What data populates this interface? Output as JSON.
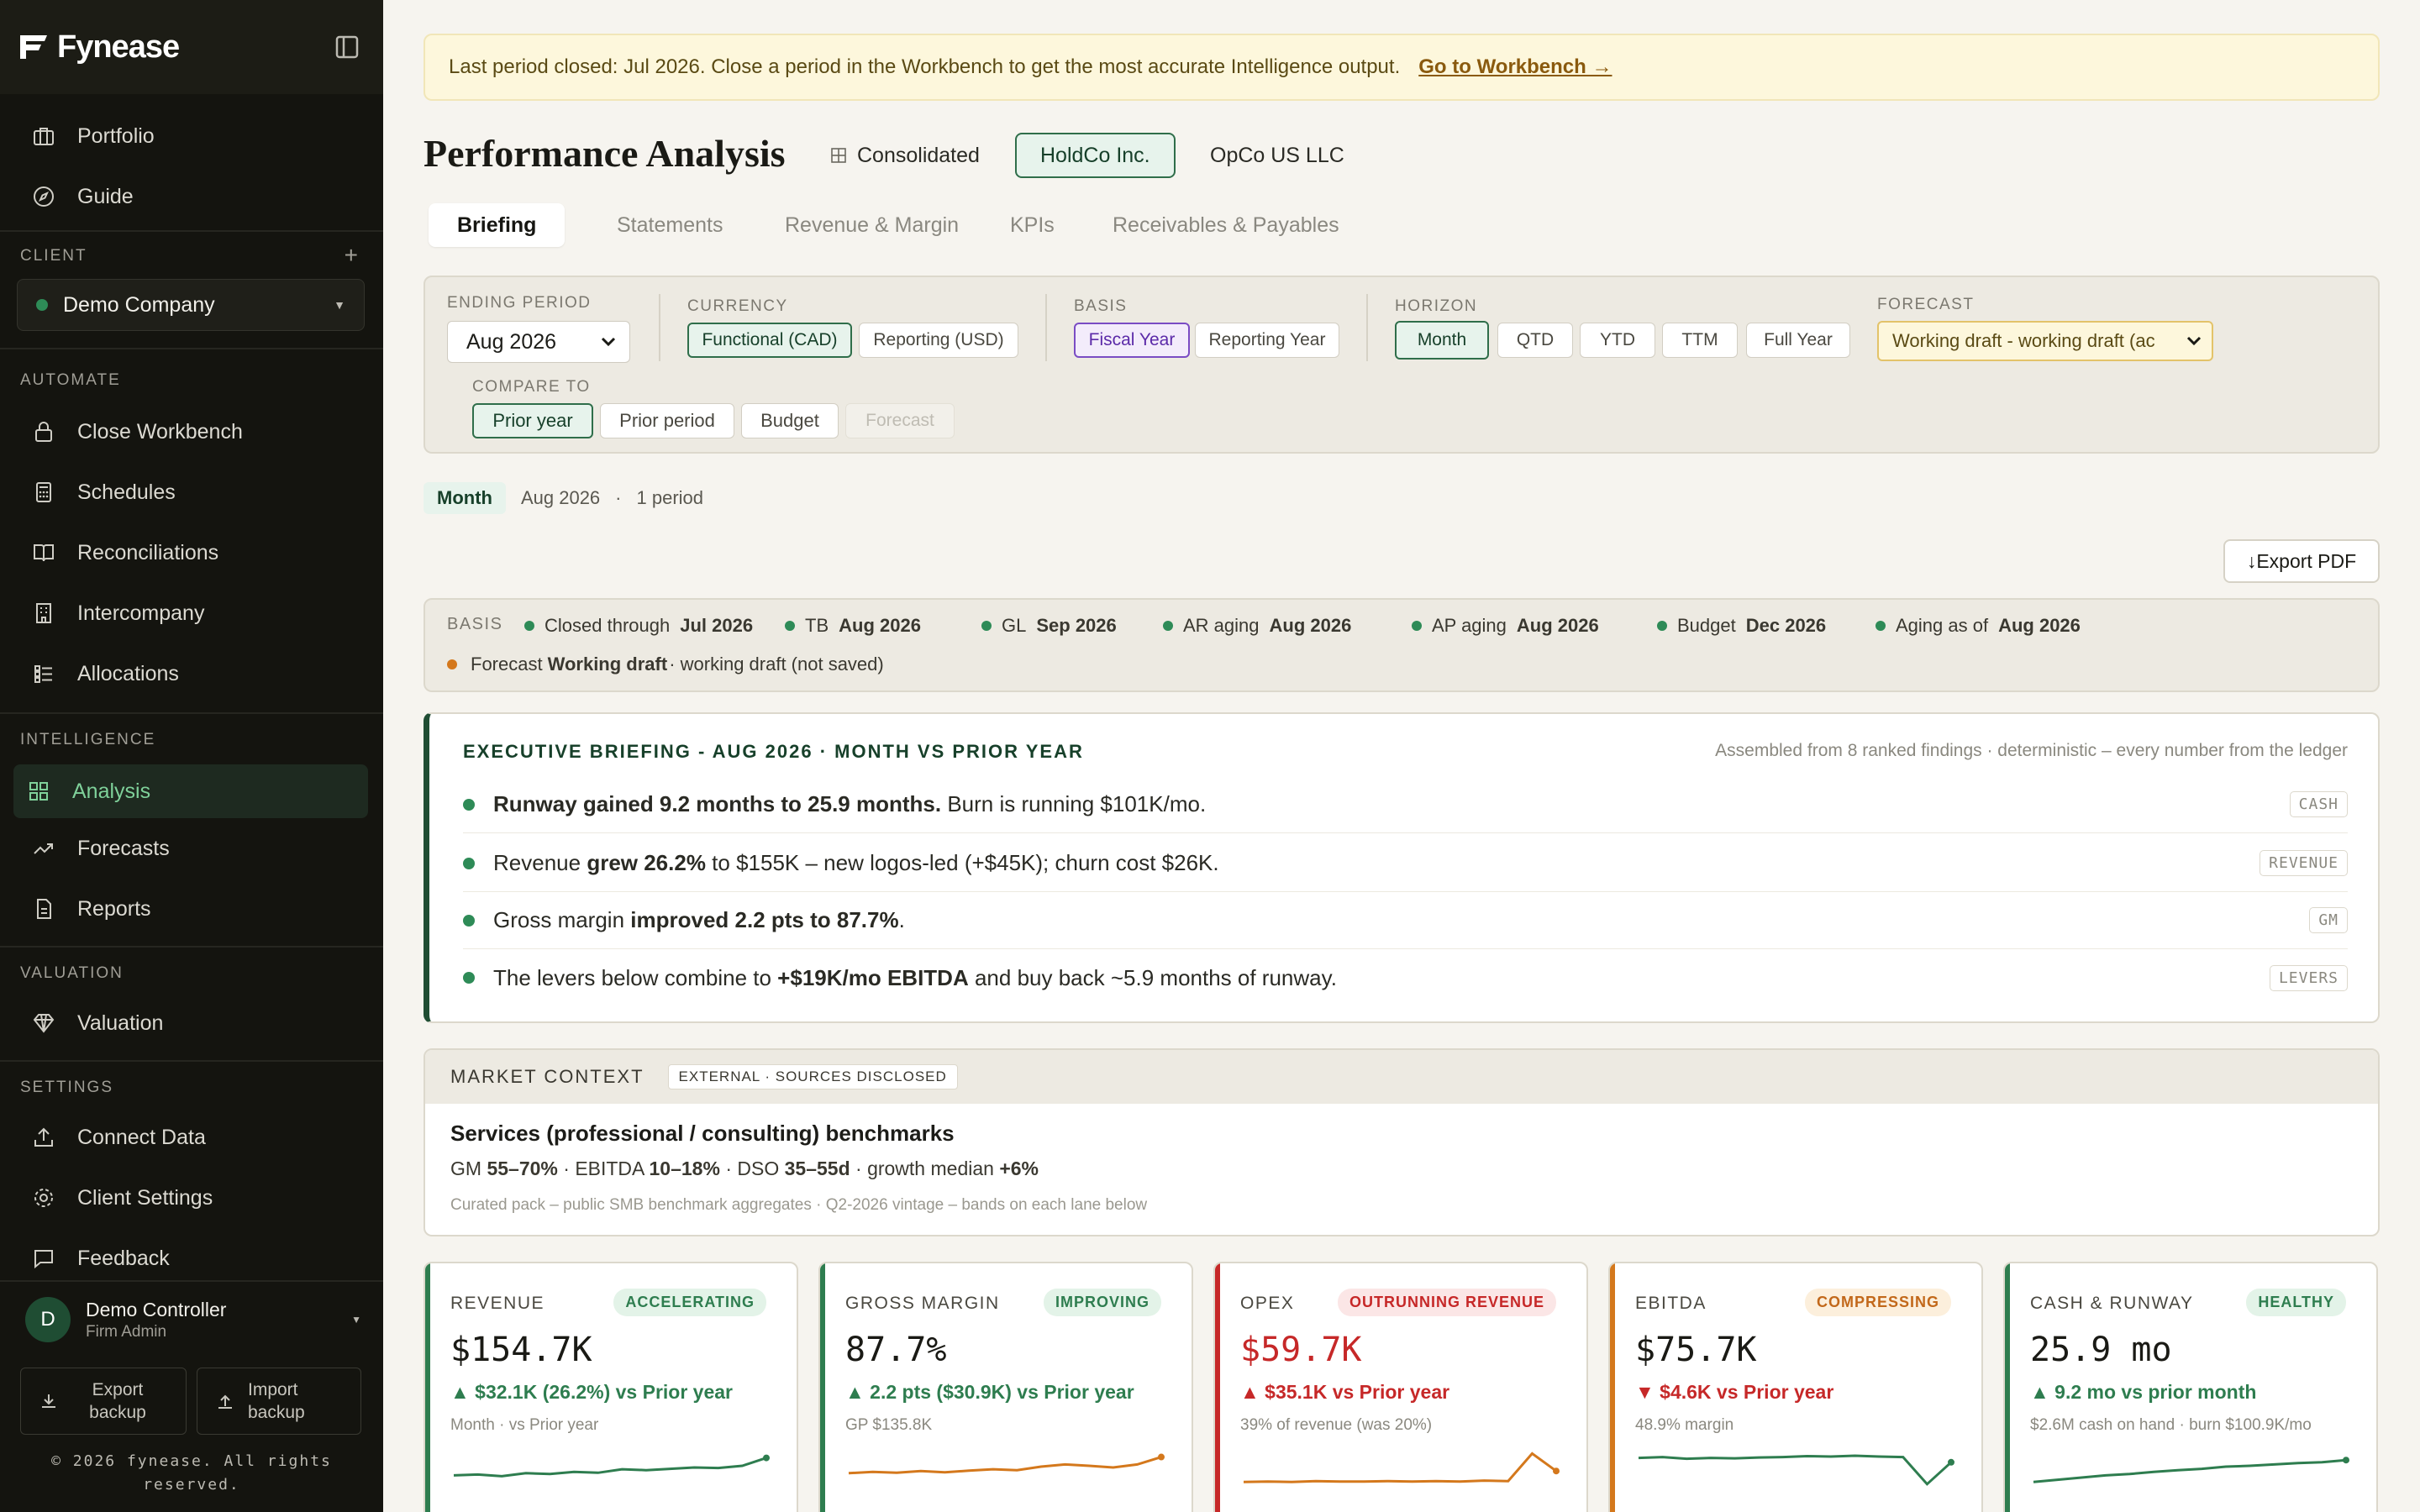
{
  "app": {
    "name": "Fynease"
  },
  "sidebar": {
    "nav_top": [
      {
        "label": "Portfolio",
        "icon": "briefcase-icon"
      },
      {
        "label": "Guide",
        "icon": "compass-icon"
      }
    ],
    "client_section": {
      "label": "CLIENT",
      "add_symbol": "+",
      "selected": "Demo Company"
    },
    "automate": {
      "label": "AUTOMATE",
      "items": [
        {
          "label": "Close Workbench",
          "icon": "lock-icon"
        },
        {
          "label": "Schedules",
          "icon": "calculator-icon"
        },
        {
          "label": "Reconciliations",
          "icon": "book-icon"
        },
        {
          "label": "Intercompany",
          "icon": "building-icon"
        },
        {
          "label": "Allocations",
          "icon": "list-icon"
        }
      ]
    },
    "intelligence": {
      "label": "INTELLIGENCE",
      "items": [
        {
          "label": "Analysis",
          "icon": "grid-icon",
          "active": true
        },
        {
          "label": "Forecasts",
          "icon": "trend-up-icon"
        },
        {
          "label": "Reports",
          "icon": "document-icon"
        }
      ]
    },
    "valuation": {
      "label": "VALUATION",
      "items": [
        {
          "label": "Valuation",
          "icon": "diamond-icon"
        }
      ]
    },
    "settings": {
      "label": "SETTINGS",
      "items": [
        {
          "label": "Connect Data",
          "icon": "upload-icon"
        },
        {
          "label": "Client Settings",
          "icon": "gear-icon"
        },
        {
          "label": "Feedback",
          "icon": "chat-icon"
        }
      ]
    },
    "user": {
      "initial": "D",
      "name": "Demo Controller",
      "role": "Firm Admin"
    },
    "export_backup": "Export backup",
    "import_backup": "Import backup",
    "copyright": "© 2026 fynease. All rights reserved."
  },
  "banner": {
    "text": "Last period closed: Jul 2026. Close a period in the Workbench to get the most accurate Intelligence output.",
    "link": "Go to Workbench →"
  },
  "page": {
    "title": "Performance Analysis",
    "entities": [
      {
        "label": "Consolidated"
      },
      {
        "label": "HoldCo Inc.",
        "active": true
      },
      {
        "label": "OpCo US LLC"
      }
    ],
    "tabs": [
      {
        "label": "Briefing",
        "active": true
      },
      {
        "label": "Statements"
      },
      {
        "label": "Revenue & Margin"
      },
      {
        "label": "KPIs"
      },
      {
        "label": "Receivables & Payables"
      }
    ]
  },
  "filters": {
    "ending_period": {
      "label": "ENDING PERIOD",
      "value": "Aug 2026"
    },
    "currency": {
      "label": "CURRENCY",
      "options": [
        "Functional (CAD)",
        "Reporting (USD)"
      ],
      "selected": "Functional (CAD)"
    },
    "basis": {
      "label": "BASIS",
      "options": [
        "Fiscal Year",
        "Reporting Year"
      ],
      "selected": "Fiscal Year"
    },
    "horizon": {
      "label": "HORIZON",
      "options": [
        "Month",
        "QTD",
        "YTD",
        "TTM",
        "Full Year"
      ],
      "selected": "Month"
    },
    "forecast": {
      "label": "FORECAST",
      "value": "Working draft - working draft (ac"
    },
    "compare_to": {
      "label": "COMPARE TO",
      "options": [
        "Prior year",
        "Prior period",
        "Budget",
        "Forecast"
      ],
      "selected": "Prior year",
      "disabled": "Forecast"
    }
  },
  "period_summary": {
    "chip": "Month",
    "period": "Aug 2026",
    "count": "1 period"
  },
  "export_pdf": "Export PDF",
  "basis_strip": {
    "label": "BASIS",
    "items": [
      {
        "text": "Closed through ",
        "bold": "Jul 2026"
      },
      {
        "text": "TB ",
        "bold": "Aug 2026"
      },
      {
        "text": "GL ",
        "bold": "Sep 2026"
      },
      {
        "text": "AR aging ",
        "bold": "Aug 2026"
      },
      {
        "text": "AP aging ",
        "bold": "Aug 2026"
      },
      {
        "text": "Budget ",
        "bold": "Dec 2026"
      },
      {
        "text": "Aging as of ",
        "bold": "Aug 2026"
      }
    ],
    "forecast": {
      "text": "Forecast ",
      "bold": "Working draft",
      "rest": " · working draft (not saved)"
    }
  },
  "executive_briefing": {
    "title": "EXECUTIVE BRIEFING - AUG 2026 · MONTH VS PRIOR YEAR",
    "note": "Assembled from 8 ranked findings · deterministic – every number from the ledger",
    "rows": [
      {
        "bold": "Runway gained 9.2 months to 25.9 months.",
        "rest": " Burn is running $101K/mo.",
        "tag": "CASH",
        "lead": ""
      },
      {
        "lead": "Revenue ",
        "bold": "grew 26.2%",
        "rest": " to $155K – new logos-led (+$45K); churn cost $26K.",
        "tag": "REVENUE"
      },
      {
        "lead": "Gross margin ",
        "bold": "improved 2.2 pts to 87.7%",
        "rest": ".",
        "tag": "GM"
      },
      {
        "lead": "The levers below combine to ",
        "bold": "+$19K/mo EBITDA",
        "rest": " and buy back ~5.9 months of runway.",
        "tag": "LEVERS"
      }
    ]
  },
  "market_context": {
    "title": "MARKET CONTEXT",
    "badge": "EXTERNAL · SOURCES DISCLOSED",
    "heading": "Services (professional / consulting) benchmarks",
    "metrics": [
      {
        "label": "GM ",
        "value": "55–70%"
      },
      {
        "label": " · EBITDA ",
        "value": "10–18%"
      },
      {
        "label": " · DSO ",
        "value": "35–55d"
      },
      {
        "label": " · growth median ",
        "value": "+6%"
      }
    ],
    "footnote": "Curated pack – public SMB benchmark aggregates · Q2-2026 vintage – bands on each lane below"
  },
  "kpi_cards": [
    {
      "name": "REVENUE",
      "badge": "ACCELERATING",
      "value": "$154.7K",
      "delta": "▲ $32.1K (26.2%) vs Prior year",
      "sub": "Month · vs Prior year",
      "tone": "good",
      "color": "#2e7d4f",
      "spark": [
        0.3,
        0.32,
        0.28,
        0.35,
        0.33,
        0.38,
        0.36,
        0.44,
        0.42,
        0.45,
        0.48,
        0.47,
        0.52,
        0.7
      ]
    },
    {
      "name": "GROSS MARGIN",
      "badge": "IMPROVING",
      "value": "87.7%",
      "delta": "▲ 2.2 pts ($30.9K) vs Prior year",
      "sub": "GP $135.8K",
      "tone": "good",
      "color": "#d4781c",
      "spark": [
        0.35,
        0.38,
        0.36,
        0.4,
        0.37,
        0.41,
        0.44,
        0.42,
        0.5,
        0.55,
        0.52,
        0.48,
        0.55,
        0.72
      ]
    },
    {
      "name": "OPEX",
      "badge": "OUTRUNNING REVENUE",
      "value": "$59.7K",
      "delta": "▲ $35.1K vs Prior year",
      "sub": "39% of revenue (was 20%)",
      "tone": "bad",
      "color": "#d4781c",
      "spark": [
        0.15,
        0.16,
        0.15,
        0.17,
        0.16,
        0.16,
        0.17,
        0.16,
        0.17,
        0.16,
        0.18,
        0.17,
        0.8,
        0.4
      ]
    },
    {
      "name": "EBITDA",
      "badge": "COMPRESSING",
      "value": "$75.7K",
      "delta": "▼ $4.6K vs Prior year",
      "sub": "48.9% margin",
      "tone": "bad",
      "color": "#2e7d4f",
      "spark": [
        0.7,
        0.72,
        0.68,
        0.7,
        0.69,
        0.71,
        0.72,
        0.74,
        0.73,
        0.75,
        0.73,
        0.72,
        0.1,
        0.6
      ]
    },
    {
      "name": "CASH & RUNWAY",
      "badge": "HEALTHY",
      "value": "25.9 mo",
      "delta": "▲ 9.2 mo vs prior month",
      "sub": "$2.6M cash on hand · burn $100.9K/mo",
      "tone": "good",
      "color": "#2e7d4f",
      "spark": [
        0.15,
        0.2,
        0.25,
        0.3,
        0.33,
        0.38,
        0.42,
        0.45,
        0.5,
        0.52,
        0.55,
        0.58,
        0.6,
        0.65
      ]
    }
  ]
}
